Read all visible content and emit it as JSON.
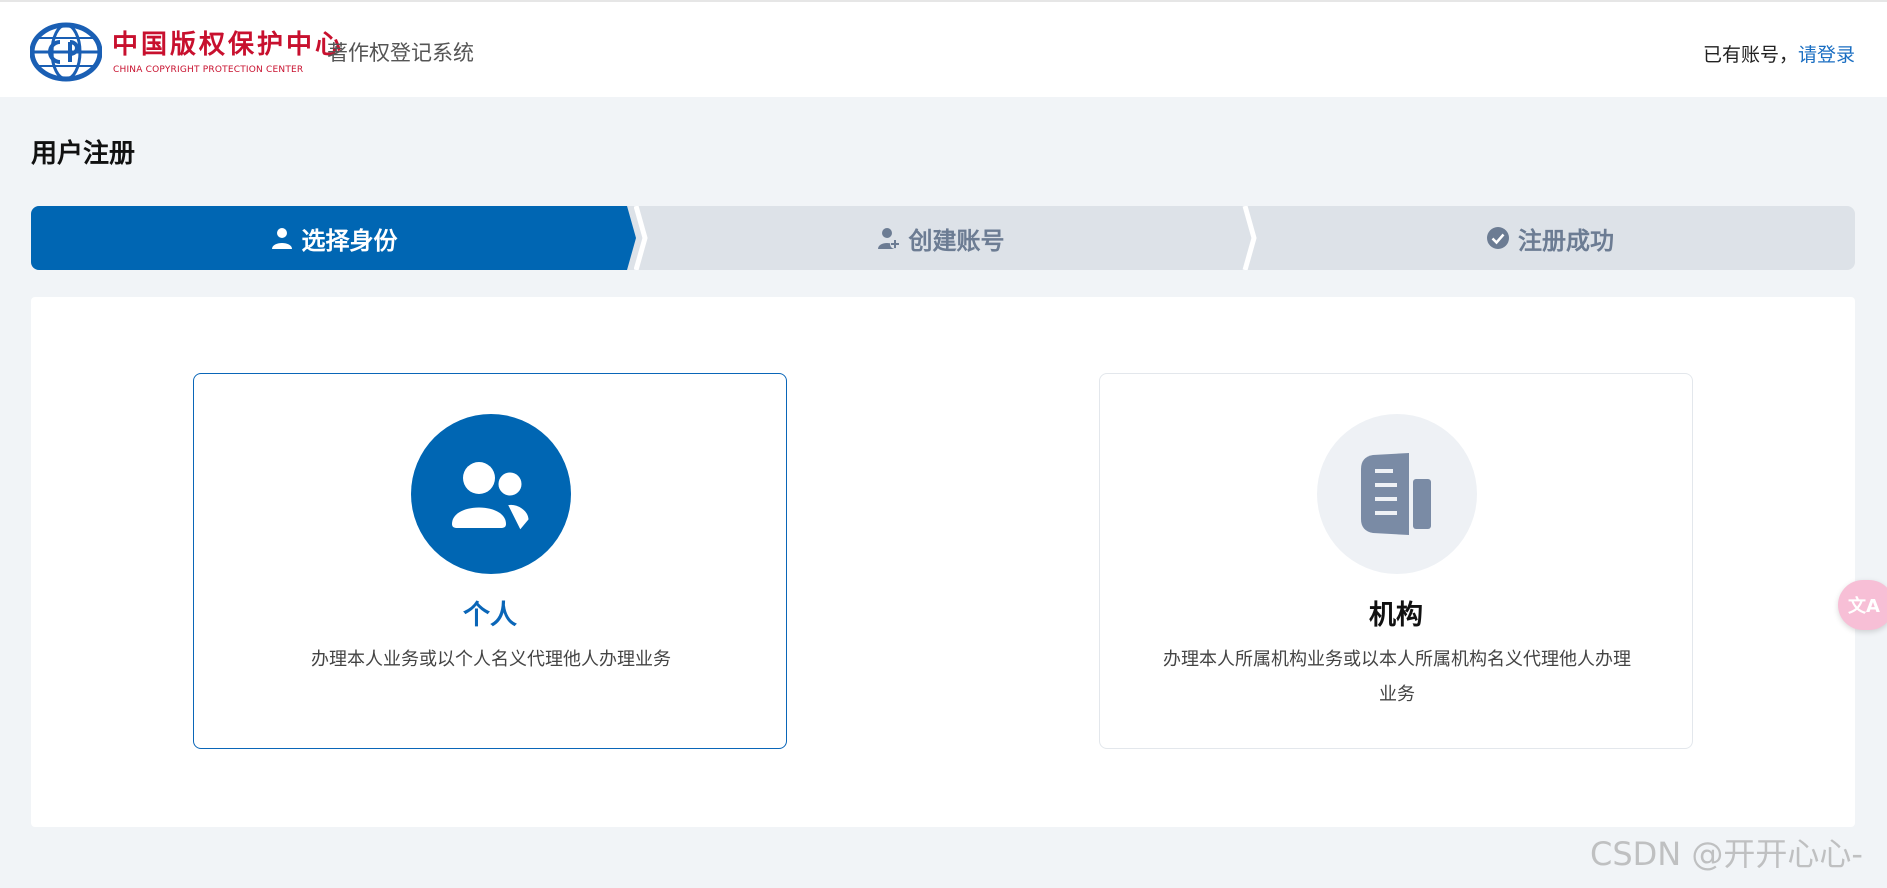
{
  "header": {
    "logo_cn": "中国版权保护中心",
    "logo_en": "CHINA COPYRIGHT PROTECTION CENTER",
    "system_name": "著作权登记系统",
    "login_prompt": "已有账号，",
    "login_link": "请登录"
  },
  "page_title": "用户注册",
  "steps": [
    {
      "label": "选择身份",
      "icon": "user-icon",
      "active": true
    },
    {
      "label": "创建账号",
      "icon": "user-plus-icon",
      "active": false
    },
    {
      "label": "注册成功",
      "icon": "check-circle-icon",
      "active": false
    }
  ],
  "cards": [
    {
      "title": "个人",
      "description": "办理本人业务或以个人名义代理他人办理业务",
      "icon": "users-icon",
      "selected": true
    },
    {
      "title": "机构",
      "description": "办理本人所属机构业务或以本人所属机构名义代理他人办理业务",
      "icon": "building-document-icon",
      "selected": false
    }
  ],
  "float_button": {
    "label": "文A",
    "icon": "translate-icon"
  },
  "watermark": "CSDN @开开心心-",
  "colors": {
    "primary": "#0066b3",
    "step_inactive_bg": "#dde2e8",
    "step_inactive_text": "#6c7c93",
    "page_bg": "#f1f4f7",
    "logo_red": "#c8102e"
  }
}
